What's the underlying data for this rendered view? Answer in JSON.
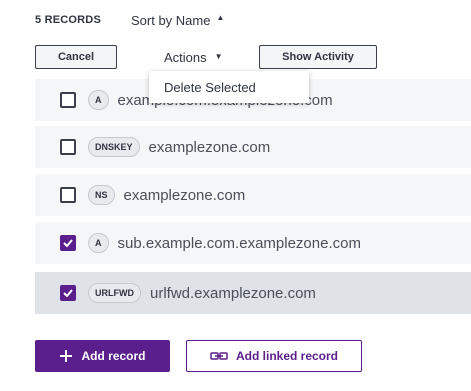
{
  "header": {
    "record_count": "5 RECORDS",
    "sort_label": "Sort by Name",
    "sort_caret": "▲"
  },
  "toolbar": {
    "cancel_label": "Cancel",
    "actions_label": "Actions",
    "actions_caret": "▼",
    "show_activity_label": "Show Activity"
  },
  "dropdown": {
    "items": [
      {
        "label": "Delete Selected"
      }
    ]
  },
  "records": [
    {
      "type": "A",
      "name": "example.com.examplezone.com",
      "checked": false
    },
    {
      "type": "DNSKEY",
      "name": "examplezone.com",
      "checked": false
    },
    {
      "type": "NS",
      "name": "examplezone.com",
      "checked": false
    },
    {
      "type": "A",
      "name": "sub.example.com.examplezone.com",
      "checked": true
    },
    {
      "type": "URLFWD",
      "name": "urlfwd.examplezone.com",
      "checked": true
    }
  ],
  "footer": {
    "add_record_label": "Add record",
    "add_linked_record_label": "Add linked record"
  },
  "colors": {
    "accent": "#5a1f8c",
    "row_bg": "#f5f6f8",
    "row_selected_bg": "#dfe2e7"
  }
}
